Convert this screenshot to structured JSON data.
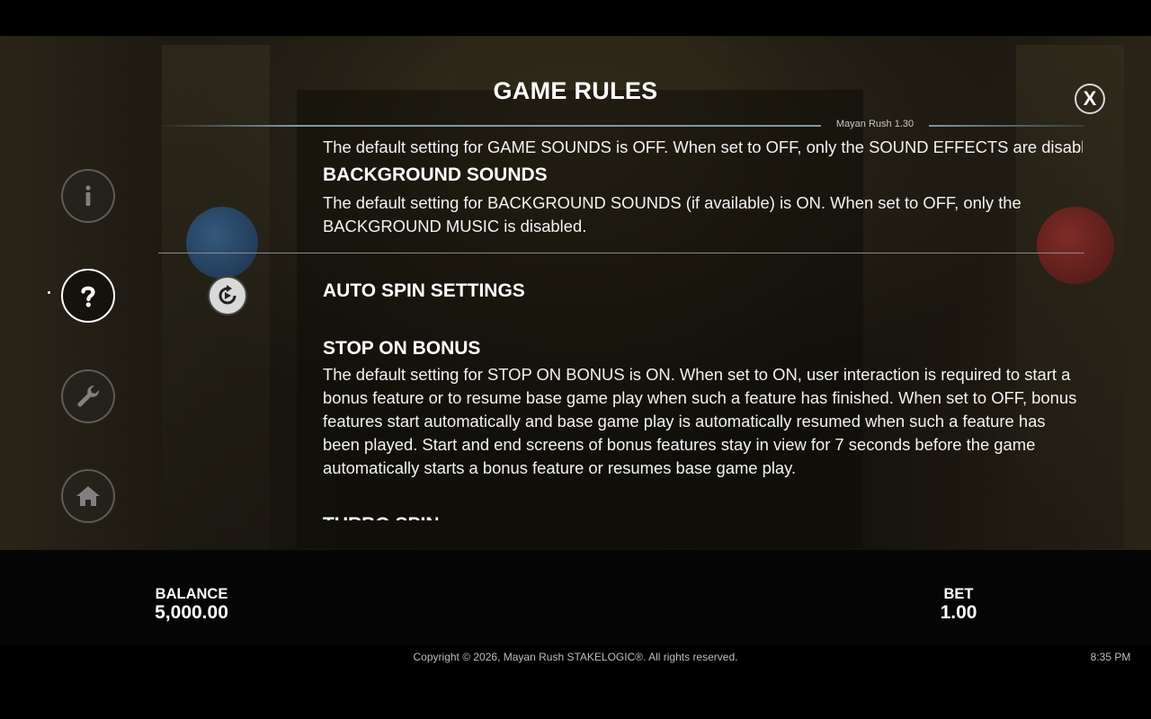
{
  "header": {
    "title": "GAME RULES",
    "version": "Mayan Rush 1.30",
    "close_label": "X"
  },
  "side_menu": {
    "items": [
      {
        "name": "info",
        "icon": "info-icon"
      },
      {
        "name": "help",
        "icon": "question-icon",
        "active": true
      },
      {
        "name": "settings",
        "icon": "wrench-icon"
      },
      {
        "name": "home",
        "icon": "home-icon"
      }
    ]
  },
  "rules": {
    "game_sounds_text": "The default setting for GAME SOUNDS is OFF. When set to OFF, only the SOUND EFFECTS are disabled.",
    "background_sounds_title": "BACKGROUND SOUNDS",
    "background_sounds_text": "The default setting for BACKGROUND SOUNDS (if available) is ON. When set to OFF, only the BACKGROUND MUSIC is disabled.",
    "auto_spin_title": "AUTO SPIN SETTINGS",
    "stop_on_bonus_title": "STOP ON BONUS",
    "stop_on_bonus_text": "The default setting for STOP ON BONUS is ON. When set to ON, user interaction is required to start a bonus feature or to resume base game play when such a feature has finished. When set to OFF, bonus features start automatically and base game play is automatically resumed when such a feature has been played. Start and end screens of bonus features stay in view for 7 seconds before the game automatically starts a bonus feature or resumes base game play.",
    "turbo_spin_title": "TURBO SPIN"
  },
  "footer": {
    "balance_label": "BALANCE",
    "balance_value": "5,000.00",
    "bet_label": "BET",
    "bet_value": "1.00",
    "copyright": "Copyright © 2026, Mayan Rush STAKELOGIC®. All rights reserved.",
    "time": "8:35 PM"
  },
  "colors": {
    "accent_line": "#7e97a8",
    "background": "#000000",
    "text": "#ffffff"
  }
}
